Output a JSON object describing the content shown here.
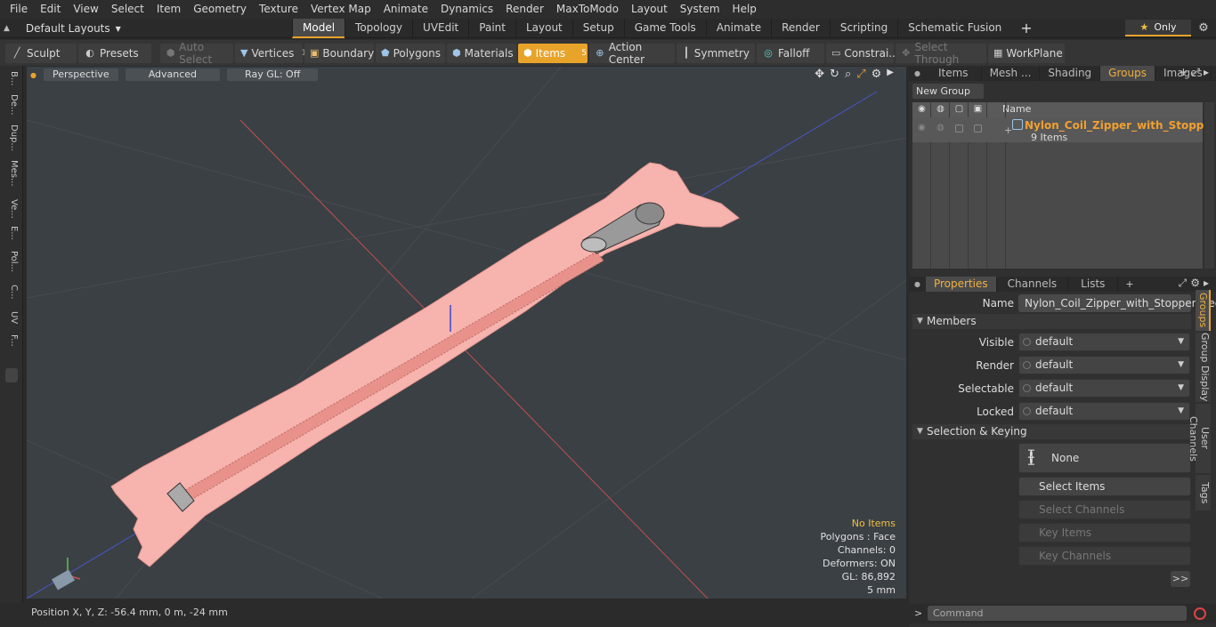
{
  "menu": [
    "File",
    "Edit",
    "View",
    "Select",
    "Item",
    "Geometry",
    "Texture",
    "Vertex Map",
    "Animate",
    "Dynamics",
    "Render",
    "MaxToModo",
    "Layout",
    "System",
    "Help"
  ],
  "layouts": {
    "label": "Default Layouts"
  },
  "mode_tabs": [
    "Model",
    "Topology",
    "UVEdit",
    "Paint",
    "Layout",
    "Setup",
    "Game Tools",
    "Animate",
    "Render",
    "Scripting",
    "Schematic Fusion"
  ],
  "only_label": "Only",
  "toolbar": {
    "sculpt": "Sculpt",
    "presets": "Presets",
    "auto_select": "Auto Select",
    "vertices": "Vertices",
    "vertices_count": "1",
    "boundary": "Boundary",
    "polygons": "Polygons",
    "materials": "Materials",
    "items": "Items",
    "items_count": "5",
    "action_center": "Action Center",
    "symmetry": "Symmetry",
    "falloff": "Falloff",
    "constraints": "Constrai...",
    "select_through": "Select Through",
    "workplane": "WorkPlane"
  },
  "left_strip": [
    "B...",
    "De...",
    "Dup...",
    "Mes...",
    "Ve...",
    "E...",
    "Pol...",
    "C...",
    "UV",
    "F..."
  ],
  "viewport": {
    "view": "Perspective",
    "shading": "Advanced",
    "raygl": "Ray GL: Off",
    "stats": {
      "items": "No Items",
      "polygons": "Polygons : Face",
      "channels": "Channels: 0",
      "deformers": "Deformers: ON",
      "gl": "GL: 86,892",
      "scale": "5 mm"
    }
  },
  "status": {
    "position": "Position X, Y, Z:   -56.4 mm, 0 m, -24 mm"
  },
  "top_tabs": [
    "Items",
    "Mesh ...",
    "Shading",
    "Groups",
    "Images"
  ],
  "groups": {
    "new_group": "New Group",
    "col_name": "Name",
    "row_title": "Nylon_Coil_Zipper_with_Stoppe ...",
    "row_sub": "9 Items"
  },
  "prop_tabs": [
    "Properties",
    "Channels",
    "Lists"
  ],
  "properties": {
    "name_label": "Name",
    "name_value": "Nylon_Coil_Zipper_with_Stopper_Red",
    "members": "Members",
    "visible_label": "Visible",
    "visible_value": "default",
    "render_label": "Render",
    "render_value": "default",
    "selectable_label": "Selectable",
    "selectable_value": "default",
    "locked_label": "Locked",
    "locked_value": "default",
    "selection_keying": "Selection & Keying",
    "none_btn": "None",
    "select_items": "Select Items",
    "select_channels": "Select Channels",
    "key_items": "Key Items",
    "key_channels": "Key Channels",
    "more": ">>"
  },
  "side_tabs": [
    "Groups",
    "Group Display",
    "User Channels",
    "Tags"
  ],
  "command": {
    "placeholder": "Command",
    "prompt": ">"
  },
  "colors": {
    "accent": "#e8a32b",
    "zipper_tape": "#f7b3ae",
    "group_title": "#f0a030"
  }
}
